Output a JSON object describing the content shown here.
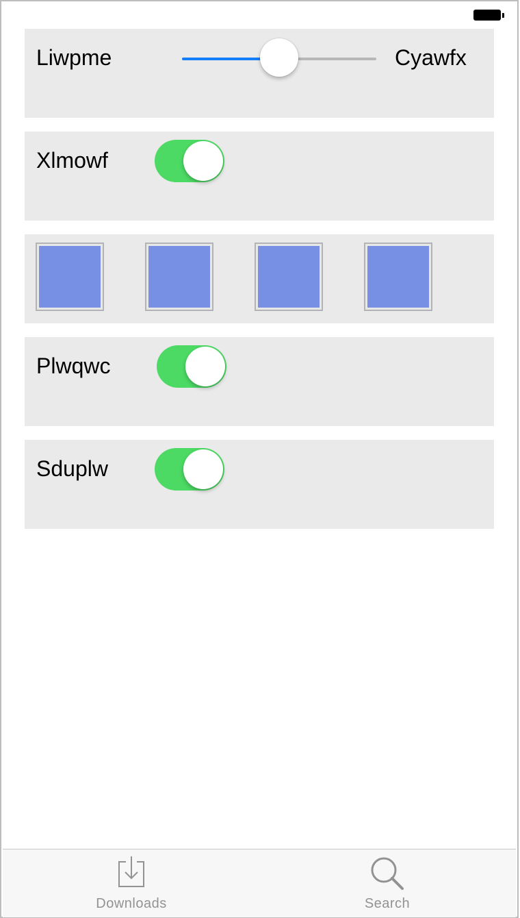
{
  "status_bar": {
    "battery_icon": "battery-icon"
  },
  "rows": [
    {
      "type": "slider",
      "min_label": "Liwpme",
      "max_label": "Cyawfx",
      "value_fraction": 0.5,
      "accent_color": "#157efb"
    },
    {
      "type": "switch",
      "label": "Xlmowf",
      "on": true
    },
    {
      "type": "swatches",
      "colors": [
        "#7890e3",
        "#7890e3",
        "#7890e3",
        "#7890e3"
      ]
    },
    {
      "type": "switch",
      "label": "Plwqwc",
      "on": true
    },
    {
      "type": "switch",
      "label": "Sduplw",
      "on": true
    }
  ],
  "switch_on_color": "#4cd964",
  "tabbar": {
    "tabs": [
      {
        "label": "Downloads",
        "icon": "downloads-icon"
      },
      {
        "label": "Search",
        "icon": "search-icon"
      }
    ]
  }
}
